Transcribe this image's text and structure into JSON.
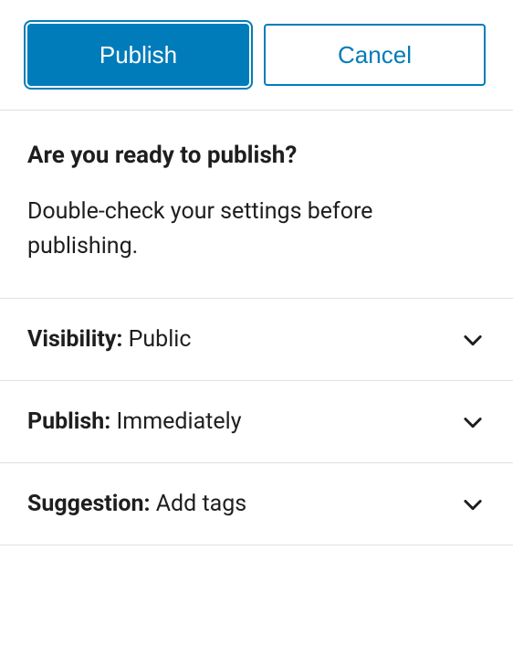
{
  "buttons": {
    "publish": "Publish",
    "cancel": "Cancel"
  },
  "intro": {
    "title": "Are you ready to publish?",
    "text": "Double-check your settings before publishing."
  },
  "settings": [
    {
      "label": "Visibility:",
      "value": "Public"
    },
    {
      "label": "Publish:",
      "value": "Immediately"
    },
    {
      "label": "Suggestion:",
      "value": "Add tags"
    }
  ]
}
